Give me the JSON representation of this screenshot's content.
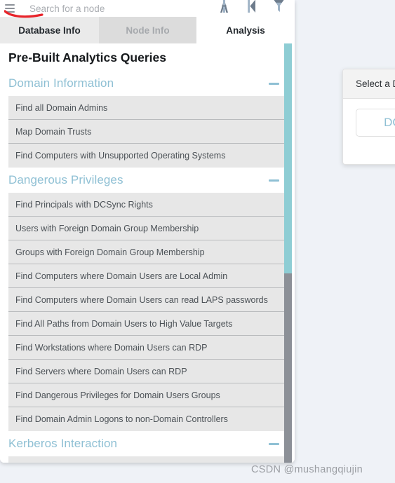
{
  "search": {
    "placeholder": "Search for a node",
    "value": ""
  },
  "topbar": {
    "menu_icon": "hamburger-menu-icon",
    "icons": [
      {
        "name": "users-icon",
        "label": "A"
      },
      {
        "name": "skip-back-icon",
        "label": "K"
      },
      {
        "name": "filter-funnel-icon",
        "label": "filter"
      }
    ]
  },
  "tabs": [
    {
      "id": "database-info",
      "label": "Database Info",
      "state": "inactive"
    },
    {
      "id": "node-info",
      "label": "Node Info",
      "state": "disabled"
    },
    {
      "id": "analysis",
      "label": "Analysis",
      "state": "active"
    }
  ],
  "panel": {
    "title": "Pre-Built Analytics Queries"
  },
  "sections": [
    {
      "id": "domain-information",
      "title": "Domain Information",
      "collapsed": false,
      "items": [
        "Find all Domain Admins",
        "Map Domain Trusts",
        "Find Computers with Unsupported Operating Systems"
      ]
    },
    {
      "id": "dangerous-privileges",
      "title": "Dangerous Privileges",
      "collapsed": false,
      "items": [
        "Find Principals with DCSync Rights",
        "Users with Foreign Domain Group Membership",
        "Groups with Foreign Domain Group Membership",
        "Find Computers where Domain Users are Local Admin",
        "Find Computers where Domain Users can read LAPS passwords",
        "Find All Paths from Domain Users to High Value Targets",
        "Find Workstations where Domain Users can RDP",
        "Find Servers where Domain Users can RDP",
        "Find Dangerous Privileges for Domain Users Groups",
        "Find Domain Admin Logons to non-Domain Controllers"
      ]
    },
    {
      "id": "kerberos-interaction",
      "title": "Kerberos Interaction",
      "collapsed": false,
      "items": []
    }
  ],
  "modal": {
    "header": "Select a D",
    "button_label": "DOM"
  },
  "watermark": "CSDN @mushangqiujin",
  "colors": {
    "accent_blue": "#8fc0d4",
    "scrollbar_teal": "#8ecdd4",
    "scrollbar_gray": "#8c9097",
    "row_background": "#e7e7e7",
    "page_background": "#eff2f7",
    "annotation_red": "#e8232a"
  }
}
